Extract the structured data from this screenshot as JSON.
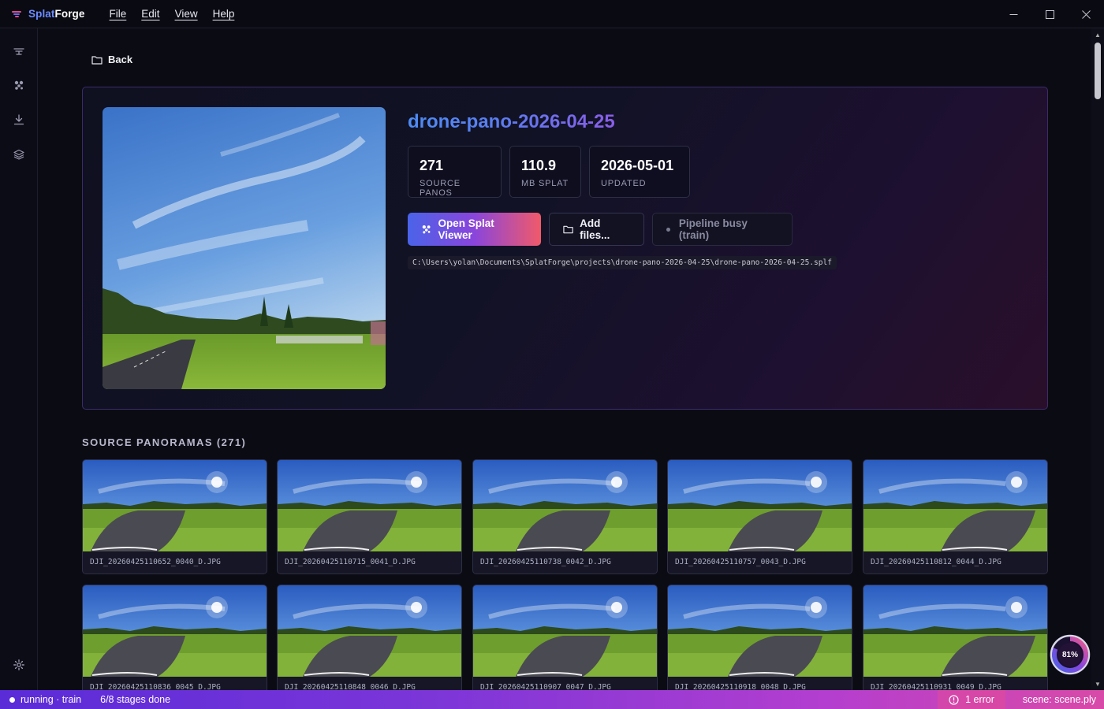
{
  "app": {
    "name_part1": "Splat",
    "name_part2": "Forge"
  },
  "menu": [
    {
      "label": "File"
    },
    {
      "label": "Edit"
    },
    {
      "label": "View"
    },
    {
      "label": "Help"
    }
  ],
  "rail": [
    {
      "name": "capture",
      "icon": "drone-icon"
    },
    {
      "name": "splats",
      "icon": "splat-icon"
    },
    {
      "name": "import",
      "icon": "download-icon"
    },
    {
      "name": "layers",
      "icon": "layers-icon"
    },
    {
      "name": "settings",
      "icon": "gear-icon"
    }
  ],
  "back_label": "Back",
  "project": {
    "title": "drone-pano-2026-04-25",
    "stats": [
      {
        "value": "271",
        "label": "SOURCE PANOS"
      },
      {
        "value": "110.9",
        "label": "MB SPLAT"
      },
      {
        "value": "2026-05-01",
        "label": "UPDATED"
      }
    ],
    "open_viewer_label": "Open Splat Viewer",
    "add_files_label": "Add files...",
    "busy_label": "Pipeline busy (train)",
    "path": "C:\\Users\\yolan\\Documents\\SplatForge\\projects\\drone-pano-2026-04-25\\drone-pano-2026-04-25.splf"
  },
  "section_title": "SOURCE PANORAMAS (271)",
  "panoramas": [
    {
      "name": "DJI_20260425110652_0040_D.JPG",
      "variant": 0
    },
    {
      "name": "DJI_20260425110715_0041_D.JPG",
      "variant": 1
    },
    {
      "name": "DJI_20260425110738_0042_D.JPG",
      "variant": 2
    },
    {
      "name": "DJI_20260425110757_0043_D.JPG",
      "variant": 3
    },
    {
      "name": "DJI_20260425110812_0044_D.JPG",
      "variant": 4
    },
    {
      "name": "DJI_20260425110836_0045_D.JPG",
      "variant": 5
    },
    {
      "name": "DJI_20260425110848_0046_D.JPG",
      "variant": 6
    },
    {
      "name": "DJI_20260425110907_0047_D.JPG",
      "variant": 7
    },
    {
      "name": "DJI_20260425110918_0048_D.JPG",
      "variant": 8
    },
    {
      "name": "DJI_20260425110931_0049_D.JPG",
      "variant": 9
    }
  ],
  "status": {
    "state": "running · train",
    "stages": "6/8 stages done",
    "errors": "1 error",
    "scene": "scene: scene.ply"
  },
  "progress": {
    "percent": 81,
    "label": "81%"
  },
  "colors": {
    "accent_blue": "#4a63e8",
    "accent_purple": "#8a45dc",
    "accent_pink": "#f05a6a",
    "background": "#0b0b14"
  }
}
